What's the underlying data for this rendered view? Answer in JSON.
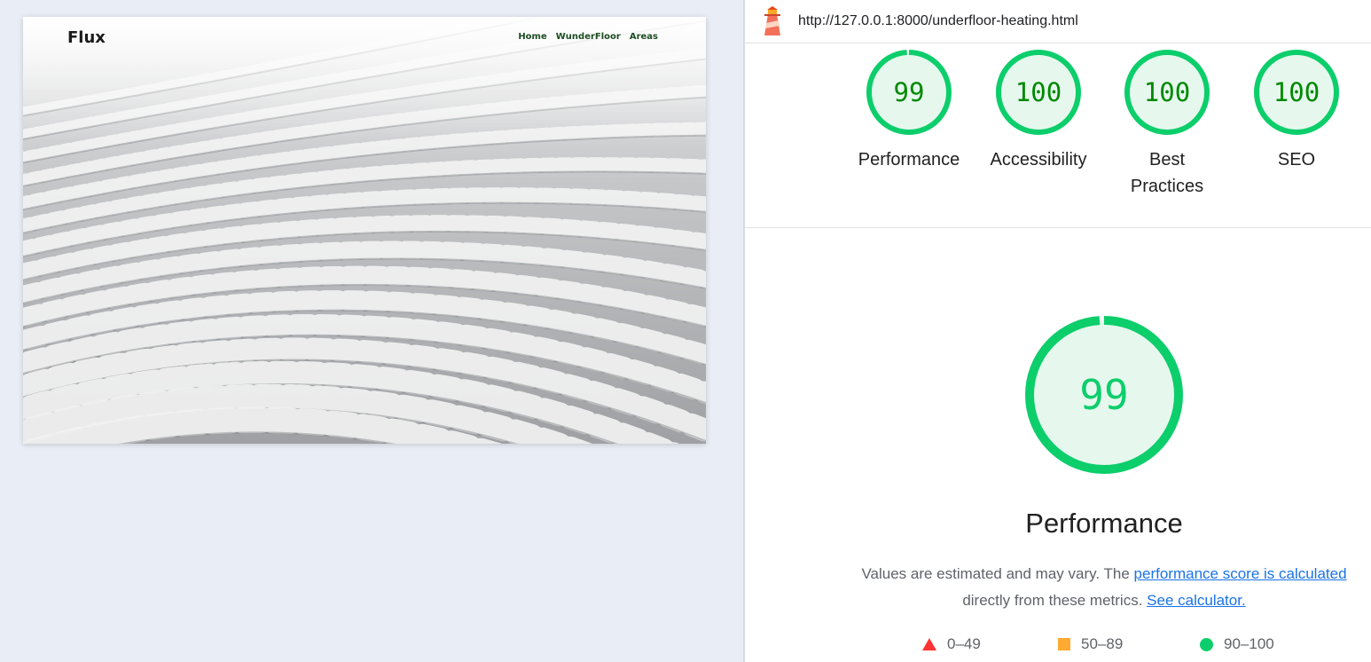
{
  "preview": {
    "logo": "Flux",
    "nav_links": [
      "Home",
      "WunderFloor",
      "Areas"
    ]
  },
  "report": {
    "url": "http://127.0.0.1:8000/underfloor-heating.html",
    "gauges": [
      {
        "label": "Performance",
        "score": "99",
        "score_value": 99
      },
      {
        "label": "Accessibility",
        "score": "100",
        "score_value": 100
      },
      {
        "label": "Best Practices",
        "score": "100",
        "score_value": 100
      },
      {
        "label": "SEO",
        "score": "100",
        "score_value": 100
      }
    ],
    "main": {
      "title": "Performance",
      "score": "99",
      "score_value": 99,
      "desc_prefix": "Values are estimated and may vary. The ",
      "desc_link1": "performance score is calculated",
      "desc_middle": " directly from these metrics. ",
      "desc_link2": "See calculator."
    },
    "legend": [
      {
        "range": "0–49",
        "shape": "triangle",
        "color": "#ff3333"
      },
      {
        "range": "50–89",
        "shape": "square",
        "color": "#ffaa33"
      },
      {
        "range": "90–100",
        "shape": "circle",
        "color": "#0cce6b"
      }
    ],
    "colors": {
      "pass": "#0cce6b",
      "pass_text": "#008800",
      "pass_bg": "#e6f8ee",
      "link": "#1a73e8"
    }
  }
}
